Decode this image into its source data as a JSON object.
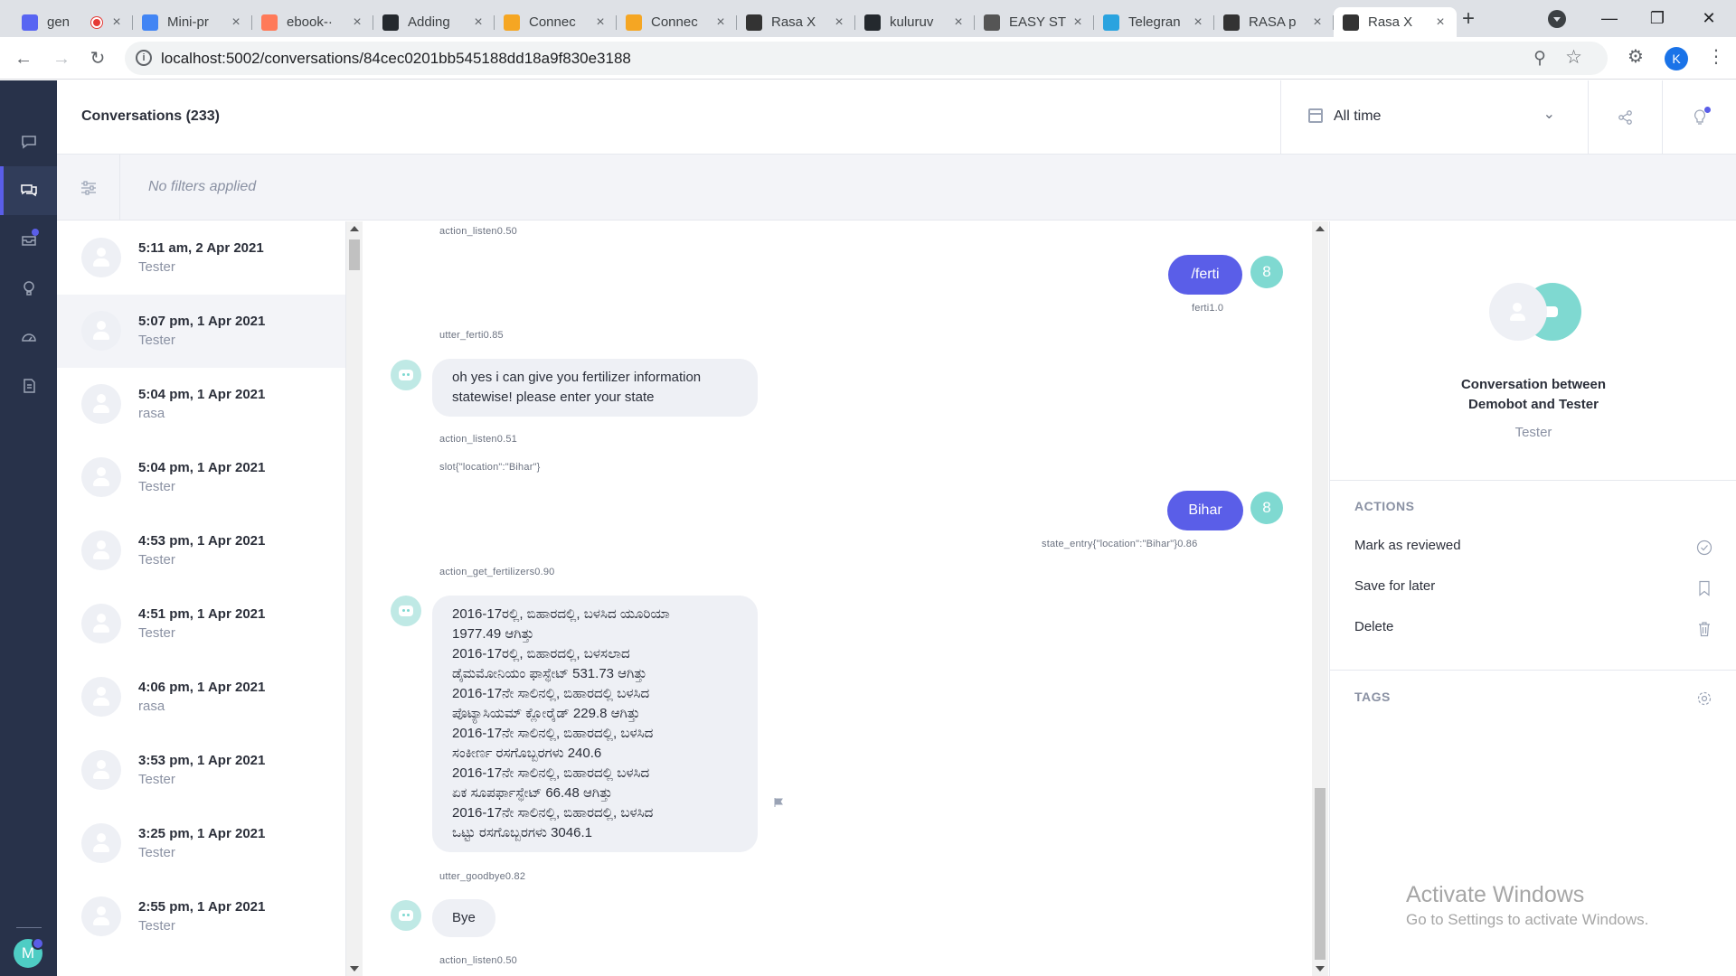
{
  "browser": {
    "tabs": [
      {
        "title": "gen",
        "icon": "discord-icon",
        "color": "#5865f2"
      },
      {
        "title": "Mini-pr",
        "icon": "docs-icon",
        "color": "#4285f4"
      },
      {
        "title": "ebook-·",
        "icon": "hubspot-icon",
        "color": "#ff7a59"
      },
      {
        "title": "Adding",
        "icon": "github-icon",
        "color": "#24292e"
      },
      {
        "title": "Connec",
        "icon": "box-icon",
        "color": "#f5a623"
      },
      {
        "title": "Connec",
        "icon": "box-icon",
        "color": "#f5a623"
      },
      {
        "title": "Rasa X",
        "icon": "rasa-icon",
        "color": "#333333"
      },
      {
        "title": "kuluruv",
        "icon": "github-icon",
        "color": "#24292e"
      },
      {
        "title": "EASY ST",
        "icon": "app-icon",
        "color": "#555555"
      },
      {
        "title": "Telegran",
        "icon": "telegram-icon",
        "color": "#2aa3df"
      },
      {
        "title": "RASA p",
        "icon": "rasa-icon",
        "color": "#333333"
      },
      {
        "title": "Rasa X",
        "icon": "rasa-icon",
        "color": "#333333"
      }
    ],
    "url": "localhost:5002/conversations/84cec0201bb545188dd18a9f830e3188",
    "profile_initial": "K"
  },
  "app": {
    "title": "Conversations (233)",
    "date_filter": "All time",
    "filters_text": "No filters applied",
    "user_avatar_initial": "M",
    "accent": "#5a5ee8",
    "teal": "#7fd9d1"
  },
  "conversations": [
    {
      "time": "5:11 am, 2 Apr 2021",
      "user": "Tester"
    },
    {
      "time": "5:07 pm, 1 Apr 2021",
      "user": "Tester"
    },
    {
      "time": "5:04 pm, 1 Apr 2021",
      "user": "rasa"
    },
    {
      "time": "5:04 pm, 1 Apr 2021",
      "user": "Tester"
    },
    {
      "time": "4:53 pm, 1 Apr 2021",
      "user": "Tester"
    },
    {
      "time": "4:51 pm, 1 Apr 2021",
      "user": "Tester"
    },
    {
      "time": "4:06 pm, 1 Apr 2021",
      "user": "rasa"
    },
    {
      "time": "3:53 pm, 1 Apr 2021",
      "user": "Tester"
    },
    {
      "time": "3:25 pm, 1 Apr 2021",
      "user": "Tester"
    },
    {
      "time": "2:55 pm, 1 Apr 2021",
      "user": "Tester"
    }
  ],
  "chat": {
    "meta1": "action_listen0.50",
    "user_msg1": "/ferti",
    "user_msg1_num": "8",
    "user_msg1_intent": "ferti1.0",
    "meta2": "utter_ferti0.85",
    "bot_msg1": "oh yes i can give you fertilizer information statewise! please enter your state",
    "meta3": "action_listen0.51",
    "meta4": "slot{\"location\":\"Bihar\"}",
    "user_msg2": "Bihar",
    "user_msg2_num": "8",
    "user_msg2_intent": "state_entry{\"location\":\"Bihar\"}0.86",
    "meta5": "action_get_fertilizers0.90",
    "bot_msg2_lines": [
      "2016-17ರಲ್ಲಿ, ಬಿಹಾರದಲ್ಲಿ, ಬಳಸಿದ ಯೂರಿಯಾ",
      "1977.49 ಆಗಿತ್ತು",
      "2016-17ರಲ್ಲಿ, ಬಿಹಾರದಲ್ಲಿ, ಬಳಸಲಾದ",
      "ಡೈಮಮೋನಿಯಂ ಫಾಸ್ಫೇಟ್ 531.73 ಆಗಿತ್ತು",
      "2016-17ನೇ ಸಾಲಿನಲ್ಲಿ, ಬಿಹಾರದಲ್ಲಿ ಬಳಸಿದ",
      "ಪೊಟ್ಯಾಸಿಯಮ್ ಕ್ಲೋರೈಡ್ 229.8 ಆಗಿತ್ತು",
      "2016-17ನೇ ಸಾಲಿನಲ್ಲಿ, ಬಿಹಾರದಲ್ಲಿ, ಬಳಸಿದ",
      "ಸಂಕೀರ್ಣ ರಸಗೊಬ್ಬರಗಳು 240.6",
      "2016-17ನೇ ಸಾಲಿನಲ್ಲಿ, ಬಿಹಾರದಲ್ಲಿ ಬಳಸಿದ",
      "ಏಕ ಸೂಪರ್ಫಾಸ್ಫೇಟ್ 66.48 ಆಗಿತ್ತು",
      "2016-17ನೇ ಸಾಲಿನಲ್ಲಿ, ಬಿಹಾರದಲ್ಲಿ, ಬಳಸಿದ",
      "ಒಟ್ಟು ರಸಗೊಬ್ಬರಗಳು 3046.1"
    ],
    "meta6": "utter_goodbye0.82",
    "bot_msg3": "Bye",
    "meta7": "action_listen0.50"
  },
  "right_panel": {
    "title_line1": "Conversation between",
    "title_line2": "Demobot and Tester",
    "subtitle": "Tester",
    "actions_heading": "ACTIONS",
    "actions": [
      "Mark as reviewed",
      "Save for later",
      "Delete"
    ],
    "tags_heading": "TAGS"
  },
  "watermark": {
    "line1": "Activate Windows",
    "line2": "Go to Settings to activate Windows."
  }
}
